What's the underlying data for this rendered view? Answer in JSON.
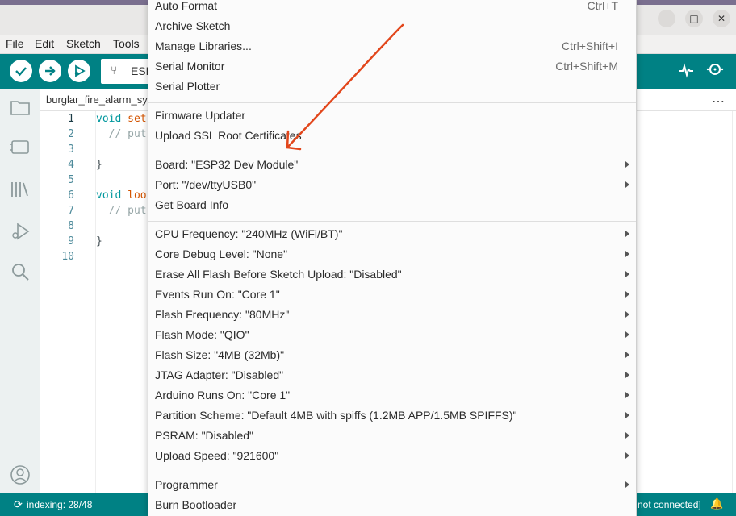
{
  "window": {
    "buttons": [
      "–",
      "□",
      "✕"
    ]
  },
  "menubar": {
    "items": [
      "File",
      "Edit",
      "Sketch",
      "Tools"
    ]
  },
  "toolbar": {
    "board_text": "ESP",
    "usb_icon": "usb-icon"
  },
  "tab": {
    "filename": "burglar_fire_alarm_sy",
    "more": "…"
  },
  "editor": {
    "line_numbers": [
      "1",
      "2",
      "3",
      "4",
      "5",
      "6",
      "7",
      "8",
      "9",
      "10"
    ],
    "lines": [
      {
        "kw": "void",
        "fn": "set",
        "cm": "",
        "pl": ""
      },
      {
        "kw": "",
        "fn": "",
        "cm": "  // put",
        "pl": ""
      },
      {
        "kw": "",
        "fn": "",
        "cm": "",
        "pl": ""
      },
      {
        "kw": "",
        "fn": "",
        "cm": "",
        "pl": "}"
      },
      {
        "kw": "",
        "fn": "",
        "cm": "",
        "pl": ""
      },
      {
        "kw": "void",
        "fn": "loo",
        "cm": "",
        "pl": ""
      },
      {
        "kw": "",
        "fn": "",
        "cm": "  // put",
        "pl": ""
      },
      {
        "kw": "",
        "fn": "",
        "cm": "",
        "pl": ""
      },
      {
        "kw": "",
        "fn": "",
        "cm": "",
        "pl": "}"
      },
      {
        "kw": "",
        "fn": "",
        "cm": "",
        "pl": ""
      }
    ]
  },
  "menu": {
    "items": [
      {
        "label": "Auto Format",
        "shortcut": "Ctrl+T",
        "submenu": false
      },
      {
        "label": "Archive Sketch",
        "shortcut": "",
        "submenu": false
      },
      {
        "label": "Manage Libraries...",
        "shortcut": "Ctrl+Shift+I",
        "submenu": false
      },
      {
        "label": "Serial Monitor",
        "shortcut": "Ctrl+Shift+M",
        "submenu": false
      },
      {
        "label": "Serial Plotter",
        "shortcut": "",
        "submenu": false
      },
      {
        "label": "Firmware Updater",
        "shortcut": "",
        "submenu": false
      },
      {
        "label": "Upload SSL Root Certificates",
        "shortcut": "",
        "submenu": false
      },
      {
        "label": "Board: \"ESP32 Dev Module\"",
        "shortcut": "",
        "submenu": true
      },
      {
        "label": "Port: \"/dev/ttyUSB0\"",
        "shortcut": "",
        "submenu": true
      },
      {
        "label": "Get Board Info",
        "shortcut": "",
        "submenu": false
      },
      {
        "label": "CPU Frequency: \"240MHz (WiFi/BT)\"",
        "shortcut": "",
        "submenu": true
      },
      {
        "label": "Core Debug Level: \"None\"",
        "shortcut": "",
        "submenu": true
      },
      {
        "label": "Erase All Flash Before Sketch Upload: \"Disabled\"",
        "shortcut": "",
        "submenu": true
      },
      {
        "label": "Events Run On: \"Core 1\"",
        "shortcut": "",
        "submenu": true
      },
      {
        "label": "Flash Frequency: \"80MHz\"",
        "shortcut": "",
        "submenu": true
      },
      {
        "label": "Flash Mode: \"QIO\"",
        "shortcut": "",
        "submenu": true
      },
      {
        "label": "Flash Size: \"4MB (32Mb)\"",
        "shortcut": "",
        "submenu": true
      },
      {
        "label": "JTAG Adapter: \"Disabled\"",
        "shortcut": "",
        "submenu": true
      },
      {
        "label": "Arduino Runs On: \"Core 1\"",
        "shortcut": "",
        "submenu": true
      },
      {
        "label": "Partition Scheme: \"Default 4MB with spiffs (1.2MB APP/1.5MB SPIFFS)\"",
        "shortcut": "",
        "submenu": true
      },
      {
        "label": "PSRAM: \"Disabled\"",
        "shortcut": "",
        "submenu": true
      },
      {
        "label": "Upload Speed: \"921600\"",
        "shortcut": "",
        "submenu": true
      },
      {
        "label": "Programmer",
        "shortcut": "",
        "submenu": true
      },
      {
        "label": "Burn Bootloader",
        "shortcut": "",
        "submenu": false
      }
    ]
  },
  "statusbar": {
    "indexing": "indexing: 28/48",
    "connection": "not connected]"
  },
  "colors": {
    "teal": "#008184",
    "annotation": "#e2461b"
  }
}
